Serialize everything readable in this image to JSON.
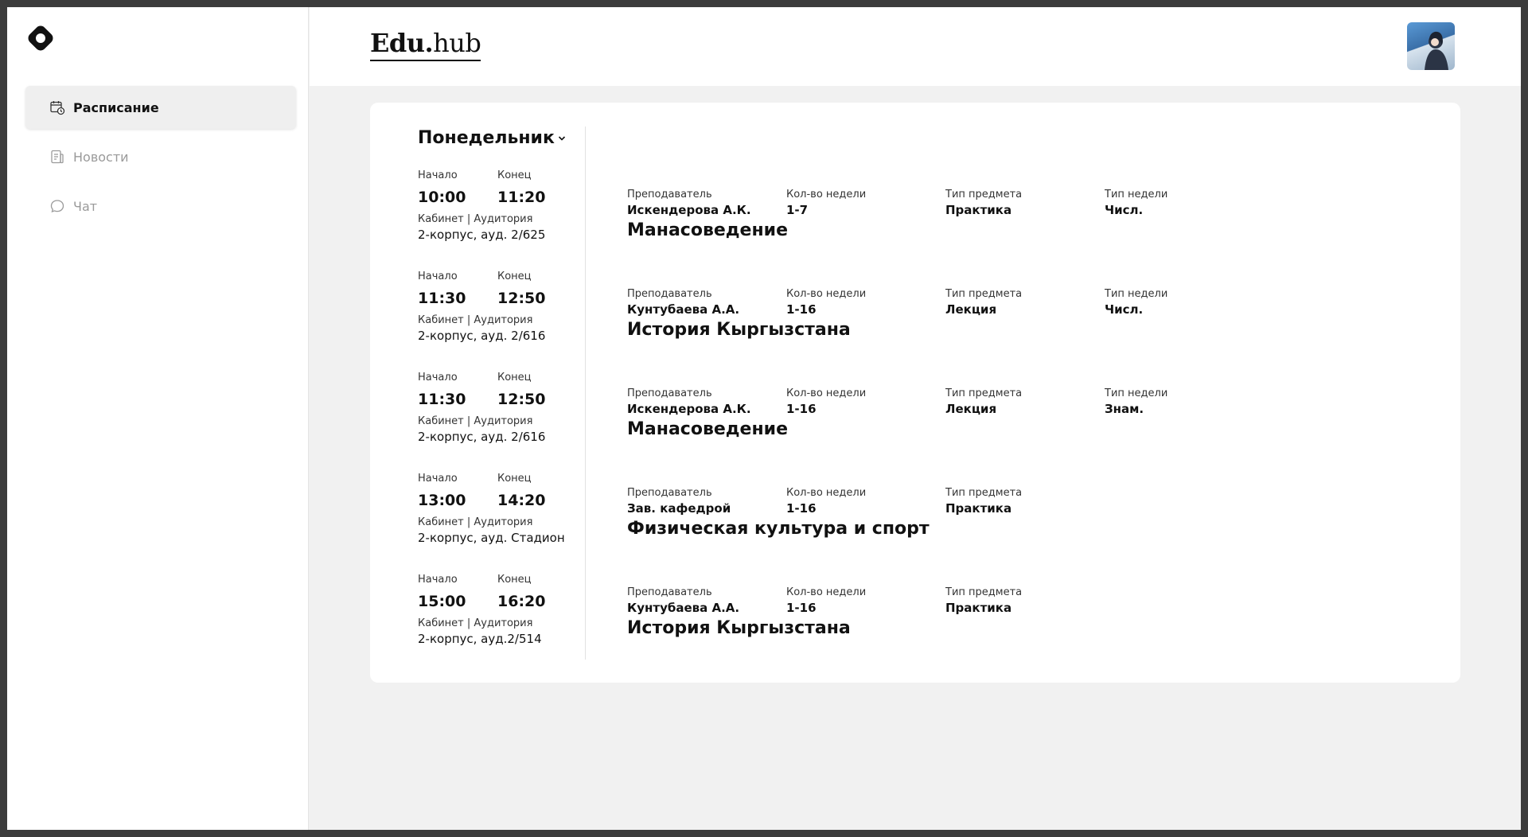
{
  "sidebar": {
    "logo_icon": "brand-logo-icon",
    "items": [
      {
        "label": "Расписание",
        "icon": "calendar-clock-icon",
        "active": true
      },
      {
        "label": "Новости",
        "icon": "news-icon",
        "active": false
      },
      {
        "label": "Чат",
        "icon": "chat-bubble-icon",
        "active": false
      }
    ]
  },
  "header": {
    "brand_bold": "Edu.",
    "brand_light": "hub",
    "avatar_icon": "user-avatar"
  },
  "schedule": {
    "day": "Понедельник",
    "labels": {
      "start": "Начало",
      "end": "Конец",
      "room": "Кабинет | Аудитория",
      "teacher": "Преподаватель",
      "weeks": "Кол-во недели",
      "subject_type": "Тип предмета",
      "week_type": "Тип недели"
    },
    "slots": [
      {
        "start": "10:00",
        "end": "11:20",
        "room": "2-корпус, ауд. 2/625"
      },
      {
        "start": "11:30",
        "end": "12:50",
        "room": "2-корпус, ауд. 2/616"
      },
      {
        "start": "11:30",
        "end": "12:50",
        "room": "2-корпус, ауд. 2/616"
      },
      {
        "start": "13:00",
        "end": "14:20",
        "room": "2-корпус, ауд. Стадион"
      },
      {
        "start": "15:00",
        "end": "16:20",
        "room": "2-корпус, ауд.2/514"
      }
    ],
    "lessons": [
      {
        "teacher": "Искендерова А.К.",
        "weeks": "1-7",
        "subject_type": "Практика",
        "week_type": "Числ.",
        "subject": "Манасоведение"
      },
      {
        "teacher": "Кунтубаева А.А.",
        "weeks": "1-16",
        "subject_type": "Лекция",
        "week_type": "Числ.",
        "subject": "История Кыргызстана"
      },
      {
        "teacher": "Искендерова А.К.",
        "weeks": "1-16",
        "subject_type": "Лекция",
        "week_type": "Знам.",
        "subject": "Манасоведение"
      },
      {
        "teacher": "Зав. кафедрой",
        "weeks": "1-16",
        "subject_type": "Практика",
        "subject": "Физическая культура и спорт"
      },
      {
        "teacher": "Кунтубаева А.А.",
        "weeks": "1-16",
        "subject_type": "Практика",
        "subject": "История Кыргызстана"
      }
    ]
  }
}
